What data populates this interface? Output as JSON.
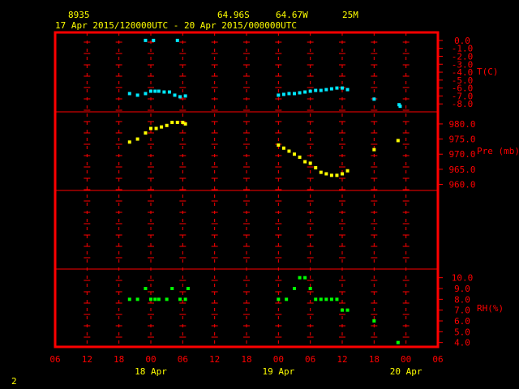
{
  "header": {
    "station": "8935",
    "lat": "64.96S",
    "lon": "64.67W",
    "elev": "25M",
    "period": "17 Apr 2015/120000UTC - 20 Apr 2015/000000UTC"
  },
  "footer": {
    "page": "2"
  },
  "colors": {
    "frame": "#ff0000",
    "axis_text": "#ff0000",
    "header_text": "#ffff00",
    "temperature": "#00e8ff",
    "pressure": "#ffff00",
    "humidity": "#00ff00"
  },
  "chart_data": {
    "type": "scatter",
    "grid": true,
    "x_axis": {
      "unit": "hours_from_17_Apr_06UTC",
      "range": [
        0,
        72
      ],
      "tick_step": 6,
      "tick_labels": [
        "06",
        "12",
        "18",
        "00",
        "06",
        "12",
        "18",
        "00",
        "06",
        "12",
        "18",
        "00",
        "06"
      ],
      "date_labels": [
        {
          "text": "18 Apr",
          "hour": 18
        },
        {
          "text": "19 Apr",
          "hour": 42
        },
        {
          "text": "20 Apr",
          "hour": 66
        }
      ]
    },
    "panels": [
      {
        "id": "temperature",
        "label": "T(C)",
        "ylim": [
          -9,
          0.6
        ],
        "ticks": [
          "0.0",
          "-1.0",
          "-2.0",
          "-3.0",
          "-4.0",
          "-5.0",
          "-6.0",
          "-7.0",
          "-8.0"
        ],
        "tick_values": [
          0,
          -1,
          -2,
          -3,
          -4,
          -5,
          -6,
          -7,
          -8
        ],
        "points": [
          [
            17,
            0
          ],
          [
            18.5,
            0
          ],
          [
            23,
            0
          ],
          [
            14,
            -6.7
          ],
          [
            15.5,
            -6.9
          ],
          [
            17,
            -6.7
          ],
          [
            18,
            -6.4
          ],
          [
            18.8,
            -6.4
          ],
          [
            19.5,
            -6.4
          ],
          [
            20.5,
            -6.5
          ],
          [
            21.5,
            -6.5
          ],
          [
            22.5,
            -6.9
          ],
          [
            23.5,
            -7.1
          ],
          [
            24.5,
            -7.0
          ],
          [
            42,
            -6.9
          ],
          [
            43,
            -6.8
          ],
          [
            44,
            -6.7
          ],
          [
            45,
            -6.7
          ],
          [
            46,
            -6.6
          ],
          [
            47,
            -6.5
          ],
          [
            48,
            -6.4
          ],
          [
            49,
            -6.3
          ],
          [
            50,
            -6.3
          ],
          [
            51,
            -6.2
          ],
          [
            52,
            -6.1
          ],
          [
            53,
            -6.0
          ],
          [
            54,
            -6.0
          ],
          [
            55,
            -6.2
          ],
          [
            60,
            -7.4
          ],
          [
            64.7,
            -8.1
          ],
          [
            64.9,
            -8.3
          ]
        ]
      },
      {
        "id": "pressure",
        "label": "Pre (mb)",
        "ylim": [
          958,
          984
        ],
        "ticks": [
          "980.0",
          "975.0",
          "970.0",
          "965.0",
          "960.0"
        ],
        "tick_values": [
          980,
          975,
          970,
          965,
          960
        ],
        "points": [
          [
            14,
            974
          ],
          [
            15.5,
            975
          ],
          [
            17,
            977
          ],
          [
            18,
            978.5
          ],
          [
            19,
            978.5
          ],
          [
            20,
            979
          ],
          [
            21,
            979.5
          ],
          [
            22,
            980.5
          ],
          [
            23,
            980.5
          ],
          [
            24,
            980.5
          ],
          [
            24.5,
            980
          ],
          [
            42,
            973
          ],
          [
            43,
            972
          ],
          [
            44,
            971
          ],
          [
            45,
            970
          ],
          [
            46,
            969
          ],
          [
            47,
            967.5
          ],
          [
            48,
            967
          ],
          [
            49,
            965.5
          ],
          [
            50,
            964
          ],
          [
            51,
            963.5
          ],
          [
            52,
            963
          ],
          [
            53,
            963
          ],
          [
            54,
            963.5
          ],
          [
            55,
            964.5
          ],
          [
            60,
            971.5
          ],
          [
            64.5,
            974.5
          ]
        ]
      },
      {
        "id": "humidity",
        "label": "RH(%)",
        "ylim": [
          3.6,
          10.8
        ],
        "ticks": [
          "10.0",
          "9.0",
          "8.0",
          "7.0",
          "6.0",
          "5.0",
          "4.0"
        ],
        "tick_values": [
          10,
          9,
          8,
          7,
          6,
          5,
          4
        ],
        "points": [
          [
            14,
            8
          ],
          [
            15.5,
            8
          ],
          [
            17,
            9
          ],
          [
            18,
            8
          ],
          [
            18.8,
            8
          ],
          [
            19.5,
            8
          ],
          [
            21,
            8
          ],
          [
            22,
            9
          ],
          [
            23.5,
            8
          ],
          [
            24.5,
            8
          ],
          [
            25,
            9
          ],
          [
            42,
            8
          ],
          [
            43.5,
            8
          ],
          [
            45,
            9
          ],
          [
            46,
            10
          ],
          [
            47,
            10
          ],
          [
            48,
            9
          ],
          [
            49,
            8
          ],
          [
            50,
            8
          ],
          [
            51,
            8
          ],
          [
            52,
            8
          ],
          [
            53,
            8
          ],
          [
            54,
            7
          ],
          [
            55,
            7
          ],
          [
            60,
            6
          ],
          [
            64.5,
            4
          ]
        ]
      }
    ]
  }
}
